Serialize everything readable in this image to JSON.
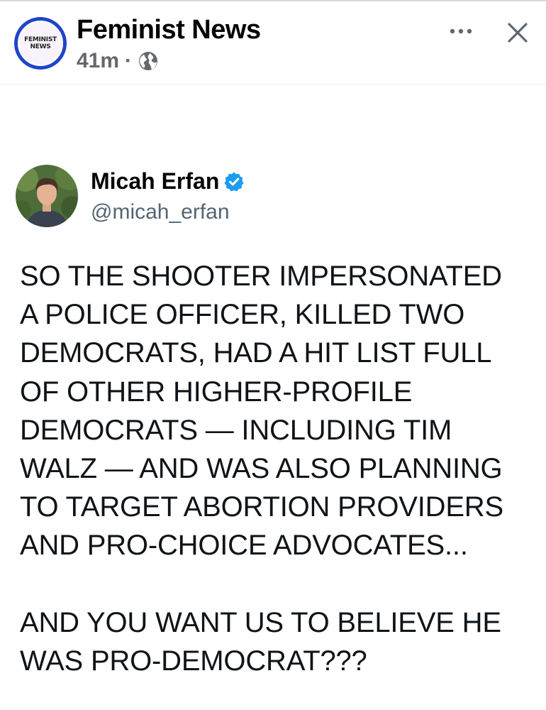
{
  "post": {
    "page_avatar_text_line1": "FEMINIST",
    "page_avatar_text_line2": "NEWS",
    "page_name": "Feminist News",
    "time": "41m",
    "separator": "·",
    "privacy_icon": "globe-icon",
    "more_icon": "more-options-icon",
    "close_icon": "close-icon"
  },
  "tweet": {
    "author_name": "Micah Erfan",
    "verified_icon": "verified-badge-icon",
    "handle": "@micah_erfan",
    "text": "SO THE SHOOTER IMPERSONATED\nA POLICE OFFICER, KILLED TWO\nDEMOCRATS, HAD A HIT LIST FULL\nOF OTHER HIGHER-PROFILE\nDEMOCRATS — INCLUDING TIM\nWALZ — AND WAS ALSO PLANNING\nTO TARGET ABORTION PROVIDERS\nAND PRO-CHOICE ADVOCATES...\n\nAND YOU WANT US TO BELIEVE HE\nWAS PRO-DEMOCRAT???"
  },
  "colors": {
    "avatar_ring": "#1f45c8",
    "meta_gray": "#65676b",
    "verified_blue": "#1d9bf0",
    "handle_gray": "#536471"
  }
}
